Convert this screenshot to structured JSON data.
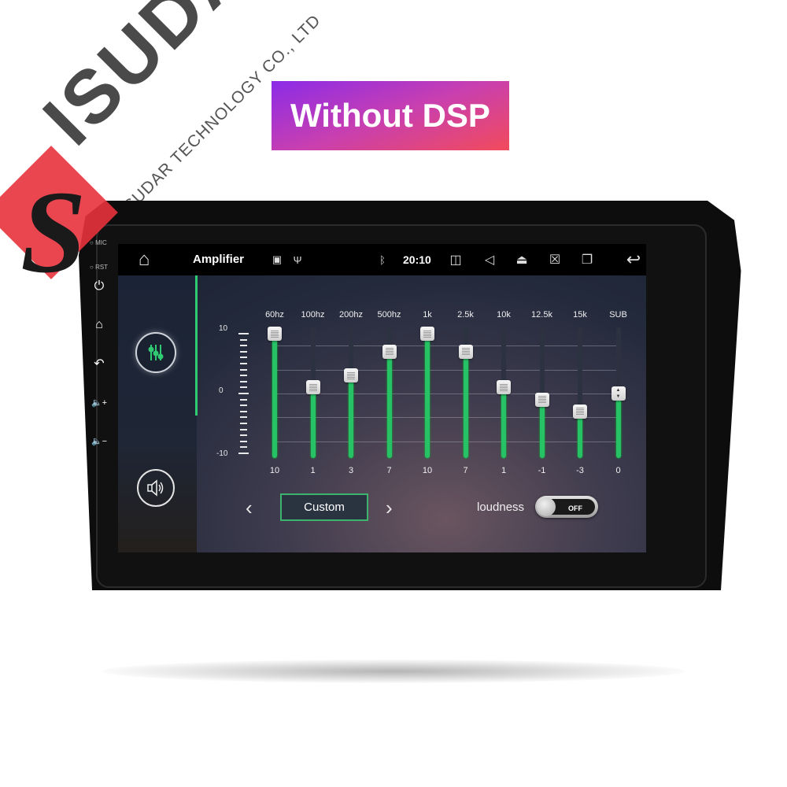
{
  "brand": {
    "name": "ISUDAR",
    "company": "ISUDAR TECHNOLOGY CO., LTD",
    "logo_letter": "S",
    "logo_color": "#e8323c"
  },
  "badge": {
    "label": "Without DSP",
    "gradient_start": "#8b2be8",
    "gradient_end": "#f24b5b"
  },
  "hardkeys": {
    "mic_label": "MIC",
    "rst_label": "RST",
    "buttons": [
      {
        "name": "power",
        "icon": "power-icon",
        "glyph": "⏻"
      },
      {
        "name": "home",
        "icon": "home-icon",
        "glyph": "⌂"
      },
      {
        "name": "back",
        "icon": "back-icon",
        "glyph": "↶"
      },
      {
        "name": "volume-up",
        "icon": "volume-up-icon",
        "glyph": "🔈+"
      },
      {
        "name": "volume-down",
        "icon": "volume-down-icon",
        "glyph": "🔈−"
      }
    ]
  },
  "statusbar": {
    "home_glyph": "⌂",
    "title": "Amplifier",
    "image_glyph": "▣",
    "usb_glyph": "Ψ",
    "bluetooth_glyph": "ᛒ",
    "time": "20:10",
    "camera_glyph": "◫",
    "speaker_glyph": "◁",
    "eject_glyph": "⏏",
    "close_screen_glyph": "☒",
    "recents_glyph": "❐",
    "back_glyph": "↩"
  },
  "sidebar_modes": [
    {
      "name": "equalizer",
      "active": true
    },
    {
      "name": "sound-field",
      "active": false
    }
  ],
  "equalizer": {
    "scale_labels": {
      "max": "10",
      "mid": "0",
      "min": "-10"
    },
    "range": [
      -10,
      10
    ],
    "accent": "#27c266",
    "bands": [
      {
        "label": "60hz",
        "value": 10
      },
      {
        "label": "100hz",
        "value": 1
      },
      {
        "label": "200hz",
        "value": 3
      },
      {
        "label": "500hz",
        "value": 7
      },
      {
        "label": "1k",
        "value": 10
      },
      {
        "label": "2.5k",
        "value": 7
      },
      {
        "label": "10k",
        "value": 1
      },
      {
        "label": "12.5k",
        "value": -1
      },
      {
        "label": "15k",
        "value": -3
      },
      {
        "label": "SUB",
        "value": 0
      }
    ]
  },
  "preset": {
    "prev_glyph": "‹",
    "next_glyph": "›",
    "current": "Custom"
  },
  "loudness": {
    "label": "loudness",
    "state": "OFF"
  }
}
